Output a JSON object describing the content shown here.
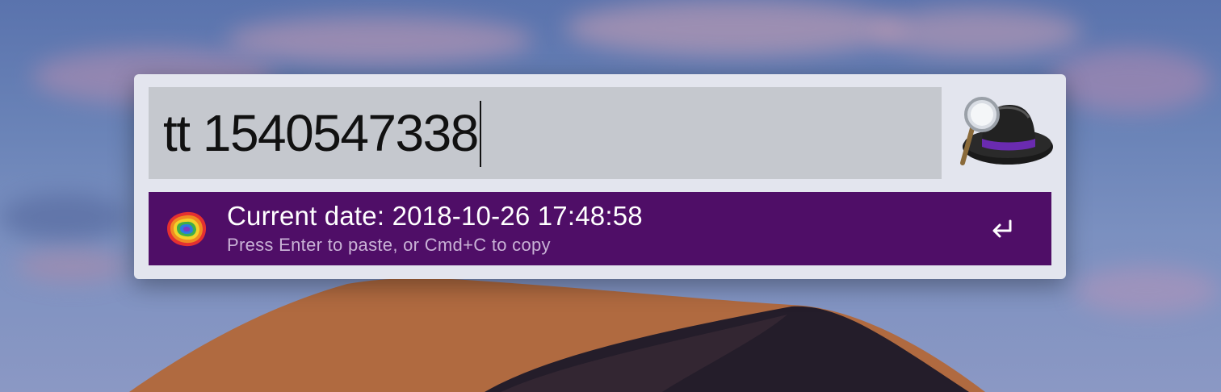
{
  "search": {
    "query": "tt 1540547338"
  },
  "app": {
    "logo_icon": "alfred-hat-icon"
  },
  "results": [
    {
      "title": "Current date: 2018-10-26 17:48:58",
      "subtitle": "Press Enter to paste, or Cmd+C to copy",
      "icon": "time-ripple-icon",
      "action_icon": "return-key-icon",
      "selected": true
    }
  ],
  "colors": {
    "selection": "#4f0e67",
    "window_background": "#e3e5ee",
    "search_field_background": "#c5c8ce",
    "subtitle_text": "#c9b2d6"
  }
}
